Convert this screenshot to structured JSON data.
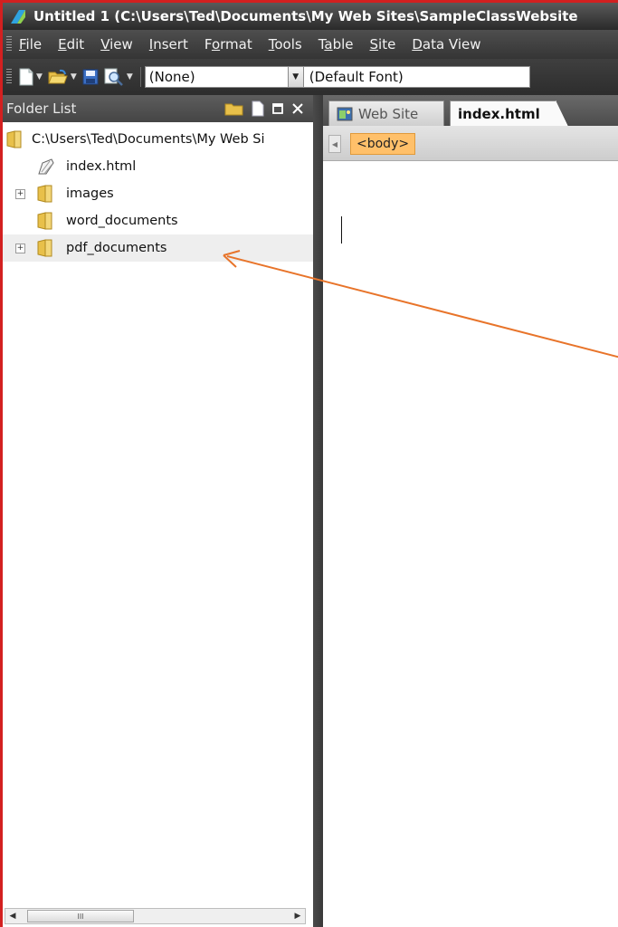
{
  "window": {
    "title": "Untitled 1 (C:\\Users\\Ted\\Documents\\My Web Sites\\SampleClassWebsite"
  },
  "menu": {
    "items": [
      {
        "label": "File",
        "u": "F",
        "rest": "ile"
      },
      {
        "label": "Edit",
        "u": "E",
        "rest": "dit"
      },
      {
        "label": "View",
        "u": "V",
        "rest": "iew"
      },
      {
        "label": "Insert",
        "u": "I",
        "rest": "nsert"
      },
      {
        "label": "Format",
        "pre": "F",
        "u": "o",
        "rest": "rmat"
      },
      {
        "label": "Tools",
        "u": "T",
        "rest": "ools"
      },
      {
        "label": "Table",
        "pre": "T",
        "u": "a",
        "rest": "ble"
      },
      {
        "label": "Site",
        "u": "S",
        "rest": "ite"
      },
      {
        "label": "Data View",
        "u": "D",
        "rest": "ata View"
      }
    ]
  },
  "toolbar": {
    "style_value": "(None)",
    "font_value": "(Default Font)"
  },
  "folder_list": {
    "title": "Folder List",
    "root": "C:\\Users\\Ted\\Documents\\My Web Si",
    "items": [
      {
        "label": "index.html",
        "type": "file"
      },
      {
        "label": "images",
        "type": "folder",
        "expandable": true
      },
      {
        "label": "word_documents",
        "type": "folder",
        "expandable": false
      },
      {
        "label": "pdf_documents",
        "type": "folder",
        "expandable": true
      }
    ],
    "scroll_thumb_grip": "III"
  },
  "editor": {
    "tabs": [
      {
        "label": "Web Site",
        "active": false
      },
      {
        "label": "index.html",
        "active": true
      }
    ],
    "tag_selector": "<body>"
  },
  "annotation": {
    "color": "#e8742a"
  },
  "colors": {
    "frame_border": "#d32020",
    "folder": "#e8c04a"
  }
}
